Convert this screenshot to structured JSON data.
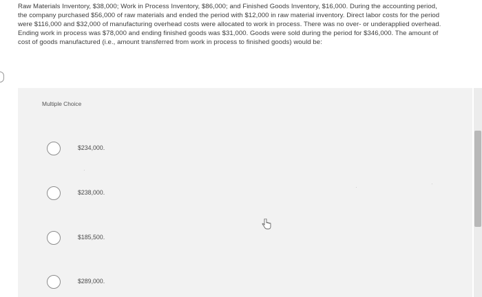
{
  "question": {
    "text": "Raw Materials Inventory, $38,000; Work in Process Inventory, $86,000; and Finished Goods Inventory, $16,000. During the accounting period, the company purchased $56,000 of raw materials and ended the period with $12,000 in raw material inventory. Direct labor costs for the period were $116,000 and $32,000 of manufacturing overhead costs were allocated to work in process. There was no over- or underapplied overhead. Ending work in process was $78,000 and ending finished goods was $31,000. Goods were sold during the period for $346,000. The amount of cost of goods manufactured (i.e., amount transferred from work in process to finished goods) would be:"
  },
  "multiple_choice": {
    "label": "Multiple Choice",
    "options": [
      {
        "label": "$234,000."
      },
      {
        "label": "$238,000."
      },
      {
        "label": "$185,500."
      },
      {
        "label": "$289,000."
      }
    ]
  },
  "icons": {
    "cursor": "hand-pointer-icon",
    "radio": "radio-unselected-icon"
  },
  "colors": {
    "panel_background": "#f2f2f2",
    "text": "#3c3c3c",
    "radio_border": "#8c8c8c"
  }
}
